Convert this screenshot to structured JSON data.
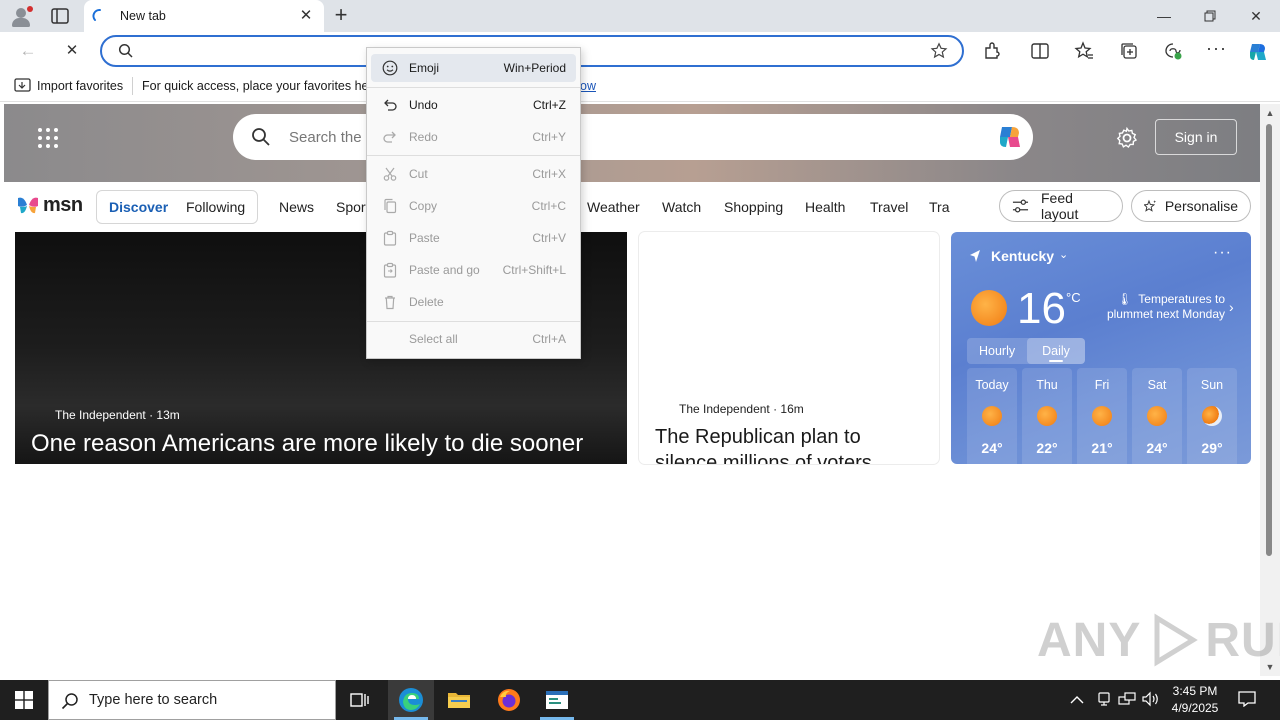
{
  "browser": {
    "tab_title": "New tab",
    "address_value": "",
    "favorites_bar": {
      "import_label": "Import favorites",
      "hint_text": "For quick access, place your favorites here on the favorites bar.",
      "manage_link": "ow"
    }
  },
  "msn": {
    "search_placeholder": "Search the",
    "sign_in": "Sign in",
    "logo_text": "msn",
    "feed_tabs": [
      "Discover",
      "Following"
    ],
    "categories": [
      "News",
      "Sport",
      "Weather",
      "Watch",
      "Shopping",
      "Health",
      "Travel",
      "Tra"
    ],
    "feed_layout": "Feed layout",
    "personalise": "Personalise",
    "main_story": {
      "source": "The Independent · 13m",
      "headline": "One reason Americans are more likely to die sooner"
    },
    "side_story": {
      "source": "The Independent · 16m",
      "headline": "The Republican plan to silence millions of voters"
    },
    "weather": {
      "location": "Kentucky",
      "temperature": "16",
      "unit": "°C",
      "alert": "Temperatures to plummet next Monday",
      "tab_hourly": "Hourly",
      "tab_daily": "Daily",
      "days": [
        {
          "name": "Today",
          "temp": "24°",
          "icon": "sun-icon"
        },
        {
          "name": "Thu",
          "temp": "22°",
          "icon": "sun-icon"
        },
        {
          "name": "Fri",
          "temp": "21°",
          "icon": "sun-icon"
        },
        {
          "name": "Sat",
          "temp": "24°",
          "icon": "sun-icon"
        },
        {
          "name": "Sun",
          "temp": "29°",
          "icon": "partly-cloudy-icon"
        }
      ]
    }
  },
  "context_menu": {
    "items": [
      {
        "label": "Emoji",
        "shortcut": "Win+Period",
        "enabled": true,
        "icon": "emoji-icon"
      },
      {
        "label": "Undo",
        "shortcut": "Ctrl+Z",
        "enabled": true,
        "icon": "undo-icon"
      },
      {
        "label": "Redo",
        "shortcut": "Ctrl+Y",
        "enabled": false,
        "icon": "redo-icon"
      },
      {
        "label": "Cut",
        "shortcut": "Ctrl+X",
        "enabled": false,
        "icon": "cut-icon"
      },
      {
        "label": "Copy",
        "shortcut": "Ctrl+C",
        "enabled": false,
        "icon": "copy-icon"
      },
      {
        "label": "Paste",
        "shortcut": "Ctrl+V",
        "enabled": false,
        "icon": "paste-icon"
      },
      {
        "label": "Paste and go",
        "shortcut": "Ctrl+Shift+L",
        "enabled": false,
        "icon": "paste-go-icon"
      },
      {
        "label": "Delete",
        "shortcut": "",
        "enabled": false,
        "icon": "delete-icon"
      },
      {
        "label": "Select all",
        "shortcut": "Ctrl+A",
        "enabled": false,
        "icon": ""
      }
    ]
  },
  "taskbar": {
    "search_placeholder": "Type here to search",
    "time": "3:45 PM",
    "date": "4/9/2025"
  },
  "watermark": "ANY RUN",
  "colors": {
    "accent": "#2f6fd1",
    "weather_bg": "#6a8fd8",
    "taskbar": "#1f1f1f"
  }
}
